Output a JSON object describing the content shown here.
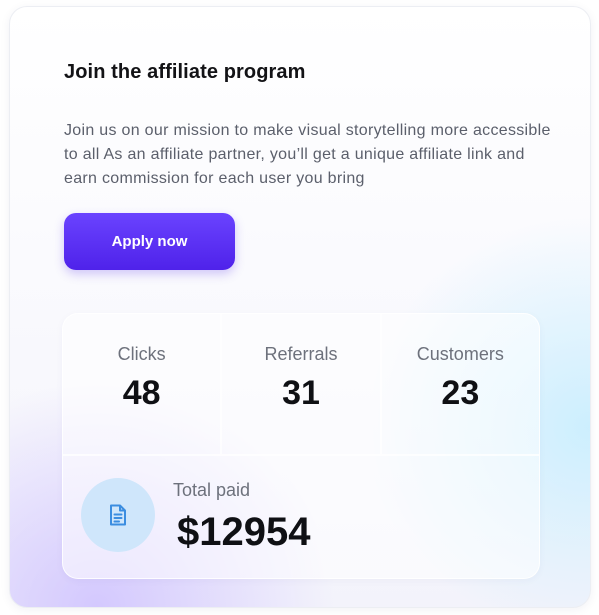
{
  "card": {
    "title": "Join the affiliate program",
    "description": "Join us on our mission to make visual storytelling more accessible to all As an affiliate partner, you’ll get a unique affiliate link and earn commission for each user you bring",
    "apply_label": "Apply now"
  },
  "stats": {
    "items": [
      {
        "label": "Clicks",
        "value": "48"
      },
      {
        "label": "Referrals",
        "value": "31"
      },
      {
        "label": "Customers",
        "value": "23"
      }
    ],
    "total": {
      "label": "Total paid",
      "value": "$12954",
      "icon": "document-icon"
    }
  },
  "colors": {
    "accent": "#5b2ef5",
    "icon_bg": "#cfe6fb",
    "icon": "#3b8de0"
  }
}
